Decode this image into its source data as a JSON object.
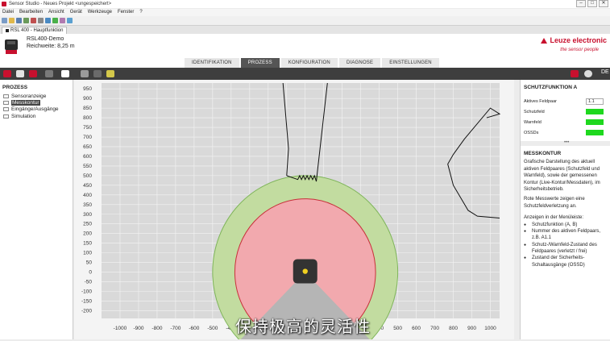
{
  "window": {
    "title": "Sensor Studio - Neues Projekt <ungespeichert>",
    "btn_min": "–",
    "btn_max": "□",
    "btn_close": "✕"
  },
  "menu": [
    "Datei",
    "Bearbeiten",
    "Ansicht",
    "Gerät",
    "Werkzeuge",
    "Fenster",
    "?"
  ],
  "doc_tab": {
    "label": "RSL 400 - Hauptfunktion"
  },
  "device": {
    "name": "RSL400-Demo",
    "range": "Reichweite: 8,25 m"
  },
  "brand": {
    "logo": "Leuze electronic",
    "tagline": "the sensor people",
    "color": "#c8102e"
  },
  "nav_tabs": [
    "IDENTIFIKATION",
    "PROZESS",
    "KONFIGURATION",
    "DIAGNOSE",
    "EINSTELLUNGEN"
  ],
  "nav_active": "PROZESS",
  "darkbar": {
    "right_label": "DE"
  },
  "left_panel": {
    "title": "PROZESS",
    "items": [
      "Sensoranzeige",
      "Messkontur",
      "Eingänge/Ausgänge",
      "Simulation"
    ],
    "selected": "Messkontur"
  },
  "right_panel": {
    "section1_title": "SCHUTZFUNKTION A",
    "active_pair_label": "Aktives Feldpaar",
    "active_pair_value": "1.1",
    "status_rows": [
      "Schutzfeld",
      "Warnfeld",
      "OSSDs"
    ],
    "led_color": "#1ed81e",
    "section2_title": "MESSKONTUR",
    "desc1": "Grafische Darstellung des aktuell aktiven Feldpaares (Schutzfeld und Warnfeld), sowie der gemessenen Kontur (Live-Kontur/Messdaten), im Sicherheitsbetrieb.",
    "desc2": "Rote Messwerte zeigen eine Schutzfeldverletzung an.",
    "desc3": "Anzeigen in der Menüleiste:",
    "bullets": [
      "Schutzfunktion (A, B)",
      "Nummer des aktiven Feldpaars, z.B. A1.1",
      "Schutz-/Warnfeld-Zustand des Feldpaares (verletzt / frei)",
      "Zustand der Sicherheits-Schaltausgänge (OSSD)"
    ]
  },
  "chart_data": {
    "type": "scatter",
    "xlim": [
      -1100,
      1050
    ],
    "ylim": [
      -240,
      980
    ],
    "xticks": [
      -1000,
      -900,
      -800,
      -700,
      -600,
      -500,
      -400,
      -300,
      -200,
      -100,
      0,
      100,
      200,
      300,
      400,
      500,
      600,
      700,
      800,
      900,
      1000
    ],
    "yticks": [
      950,
      900,
      850,
      800,
      750,
      700,
      650,
      600,
      550,
      500,
      450,
      400,
      350,
      300,
      250,
      200,
      150,
      100,
      50,
      0,
      -50,
      -100,
      -150,
      -200
    ],
    "grid": true,
    "warning_field": {
      "radius": 500,
      "color": "#c2dca0",
      "edge": "#7fb55a"
    },
    "protective_field": {
      "radius": 380,
      "color": "#f2a9ae",
      "edge": "#c8303a"
    },
    "blind_zone": {
      "color": "#b5b5b5"
    },
    "sensor_origin": [
      0,
      0
    ],
    "contour_left": [
      [
        -120,
        980
      ],
      [
        -90,
        640
      ],
      [
        -100,
        500
      ],
      [
        -40,
        490
      ],
      [
        -30,
        470
      ],
      [
        60,
        470
      ],
      [
        120,
        980
      ]
    ],
    "contour_right": [
      [
        980,
        800
      ],
      [
        1050,
        820
      ],
      [
        1000,
        850
      ],
      [
        860,
        690
      ],
      [
        800,
        610
      ],
      [
        770,
        560
      ],
      [
        800,
        450
      ],
      [
        880,
        320
      ],
      [
        930,
        290
      ],
      [
        1050,
        280
      ]
    ]
  },
  "subtitle": "保持极高的灵活性"
}
